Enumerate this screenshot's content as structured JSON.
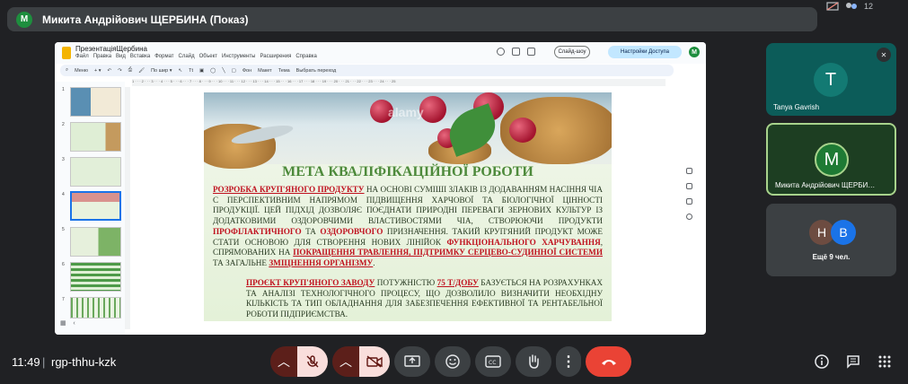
{
  "meet": {
    "presenter_avatar_letter": "M",
    "presenter_title": "Микита Андрійович ЩЕРБИНА (Показ)",
    "top_right_count": "12",
    "time": "11:49",
    "separator": "|",
    "meeting_code": "rgp-thhu-kzk",
    "participants": [
      {
        "letter": "T",
        "name": "Tanya Gavrish",
        "color": "#137a73"
      },
      {
        "letter": "M",
        "name": "Микита Андрійович ЩЕРБИ…",
        "color": "#1e7a34"
      }
    ],
    "others": {
      "letters": [
        "Н",
        "B"
      ],
      "colors": [
        "#6d4c41",
        "#1a73e8"
      ],
      "label": "Ещё 9 чел."
    }
  },
  "slides_app": {
    "doc_title": "ПрезентаціяЩербина",
    "menu": [
      "Файл",
      "Правка",
      "Вид",
      "Вставка",
      "Формат",
      "Слайд",
      "Объект",
      "Инструменты",
      "Расширения",
      "Справка"
    ],
    "slideshow_label": "Слайд-шоу",
    "access_label": "Настройки Доступа",
    "avatar_letter": "M",
    "toolbar": [
      "Меню",
      "По шир ▾",
      "Фон",
      "Макет",
      "Тема",
      "Выбрать переход"
    ],
    "thumb_numbers": [
      "1",
      "2",
      "3",
      "4",
      "5",
      "6",
      "7"
    ],
    "ruler_text": "1 · · · 2 · · · 3 · · · 4 · · · 5 · · · 6 · · · 7 · · · 8 · · · 9 · · · 10 · · · 11 · · · 12 · · · 13 · · · 14 · · · 15 · · · 16 · · · 17 · · · 18 · · · 19 · · · 20 · · · 21 · · · 22 · · · 23 · · · 24 · · · 25"
  },
  "slide": {
    "watermark": "alamy",
    "title": "МЕТА КВАЛІФІКАЦІЙНОЇ РОБОТИ",
    "p1": {
      "a": "РОЗРОБКА КРУП'ЯНОГО ПРОДУКТУ",
      "b": " НА ОСНОВІ СУМІШІ ЗЛАКІВ ІЗ ДОДАВАННЯМ НАСІННЯ ЧІА С ПЕРСПЕКТИВНИМ НАПРЯМОМ ПІДВИЩЕННЯ ХАРЧОВОЇ ТА БІОЛОГІЧНОЇ ЦІННОСТІ ПРОДУКЦІЇ. ЦЕЙ ПІДХІД ДОЗВОЛЯЄ ПОЄДНАТИ ПРИРОДНІ ПЕРЕВАГИ ЗЕРНОВИХ КУЛЬТУР ІЗ ДОДАТКОВИМИ ОЗДОРОВЧИМИ ВЛАСТИВОСТЯМИ ЧІА, СТВОРЮЮЧИ ПРОДУКТИ ",
      "c": "ПРОФІЛАКТИЧНОГО",
      "d": " ТА ",
      "e": "ОЗДОРОВЧОГО",
      "f": " ПРИЗНАЧЕННЯ. ТАКИЙ КРУП'ЯНИЙ ПРОДУКТ МОЖЕ СТАТИ ОСНОВОЮ ДЛЯ СТВОРЕННЯ НОВИХ ЛІНІЙОК ",
      "g": "ФУНКЦІОНАЛЬНОГО ХАРЧУВАННЯ",
      "h": ", СПРЯМОВАНИХ НА ",
      "i": "ПОКРАЩЕННЯ ТРАВЛЕННЯ, ПІДТРИМКУ СЕРЦЕВО-СУДИННОЇ СИСТЕМИ",
      "j": " ТА ЗАГАЛЬНЕ ",
      "k": "ЗМІЦНЕННЯ ОРГАНІЗМУ",
      "l": "."
    },
    "p2": {
      "a": "ПРОЄКТ КРУП'ЯНОГО ЗАВОДУ",
      "b": " ПОТУЖНІСТЮ ",
      "c": "75 Т/ДОБУ",
      "d": " БАЗУЄТЬСЯ НА РОЗРАХУНКАХ ТА АНАЛІЗІ ТЕХНОЛОГІЧНОГО ПРОЦЕСУ, ЩО ДОЗВОЛИЛО ВИЗНАЧИТИ НЕОБХІДНУ КІЛЬКІСТЬ ТА ТИП ОБЛАДНАННЯ ДЛЯ ЗАБЕЗПЕЧЕННЯ ЕФЕКТИВНОЇ ТА РЕНТАБЕЛЬНОЇ РОБОТИ ПІДПРИЄМСТВА."
    }
  },
  "controls": {
    "mic_state": "off",
    "cam_state": "off",
    "accent_red": "#ea4335",
    "control_bg": "#3c4043",
    "muted_bg": "#f9dedc"
  }
}
